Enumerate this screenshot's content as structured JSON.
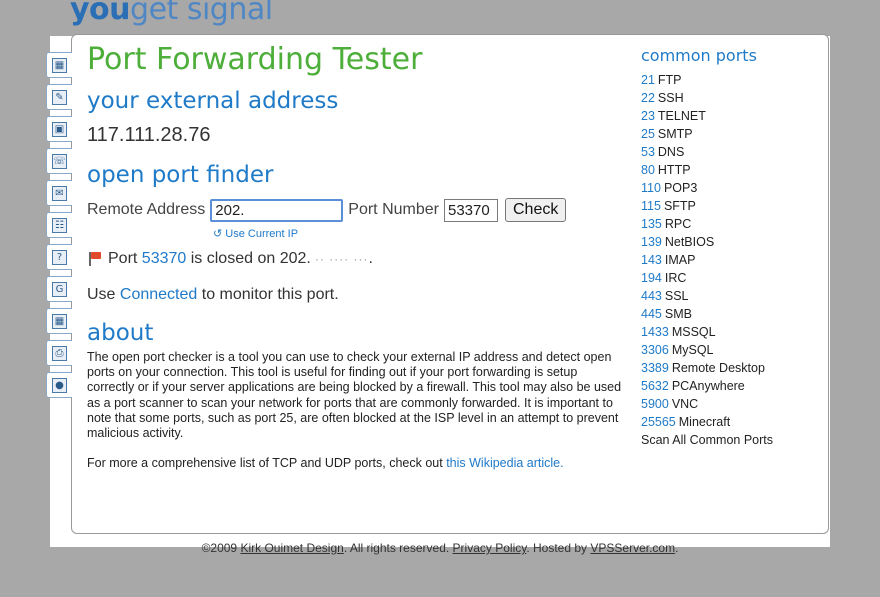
{
  "logo": {
    "part1": "you",
    "part2": "get signal"
  },
  "title": "Port Forwarding Tester",
  "external": {
    "heading": "your external address",
    "ip": "117.111.28.76"
  },
  "finder": {
    "heading": "open port finder",
    "remote_label": "Remote Address",
    "remote_value": "202.",
    "port_label": "Port Number",
    "port_value": "53370",
    "check_label": "Check",
    "use_current": "Use Current IP"
  },
  "result": {
    "prefix": "Port",
    "port": "53370",
    "middle": "is closed on 202.",
    "masked": "·· ····  ···",
    "suffix": "."
  },
  "monitor": {
    "prefix": "Use",
    "link": "Connected",
    "suffix": "to monitor this port."
  },
  "about": {
    "heading": "about",
    "text": "The open port checker is a tool you can use to check your external IP address and detect open ports on your connection. This tool is useful for finding out if your port forwarding is setup correctly or if your server applications are being blocked by a firewall. This tool may also be used as a port scanner to scan your network for ports that are commonly forwarded. It is important to note that some ports, such as port 25, are often blocked at the ISP level in an attempt to prevent malicious activity.",
    "more_prefix": "For more a comprehensive list of TCP and UDP ports, check out",
    "more_link": "this Wikipedia article."
  },
  "common": {
    "heading": "common ports",
    "ports": [
      {
        "num": "21",
        "name": "FTP"
      },
      {
        "num": "22",
        "name": "SSH"
      },
      {
        "num": "23",
        "name": "TELNET"
      },
      {
        "num": "25",
        "name": "SMTP"
      },
      {
        "num": "53",
        "name": "DNS"
      },
      {
        "num": "80",
        "name": "HTTP"
      },
      {
        "num": "110",
        "name": "POP3"
      },
      {
        "num": "115",
        "name": "SFTP"
      },
      {
        "num": "135",
        "name": "RPC"
      },
      {
        "num": "139",
        "name": "NetBIOS"
      },
      {
        "num": "143",
        "name": "IMAP"
      },
      {
        "num": "194",
        "name": "IRC"
      },
      {
        "num": "443",
        "name": "SSL"
      },
      {
        "num": "445",
        "name": "SMB"
      },
      {
        "num": "1433",
        "name": "MSSQL"
      },
      {
        "num": "3306",
        "name": "MySQL"
      },
      {
        "num": "3389",
        "name": "Remote Desktop"
      },
      {
        "num": "5632",
        "name": "PCAnywhere"
      },
      {
        "num": "5900",
        "name": "VNC"
      },
      {
        "num": "25565",
        "name": "Minecraft"
      }
    ],
    "scan_all": "Scan All Common Ports"
  },
  "footer": {
    "copy": "©2009",
    "author": "Kirk Ouimet Design",
    "rights": ". All rights reserved.",
    "privacy": "Privacy Policy",
    "hosted": ". Hosted by",
    "host": "VPSServer.com",
    "end": "."
  },
  "sidebar": {
    "icons": [
      "lock-icon",
      "pencil-icon",
      "image-icon",
      "phone-icon",
      "email-icon",
      "network-icon",
      "help-icon",
      "google-icon",
      "windows-icon",
      "printer-icon",
      "globe-icon"
    ]
  },
  "colors": {
    "title": "#4dae3a",
    "heading": "#1f7ac8",
    "link": "#1f7ac8"
  }
}
